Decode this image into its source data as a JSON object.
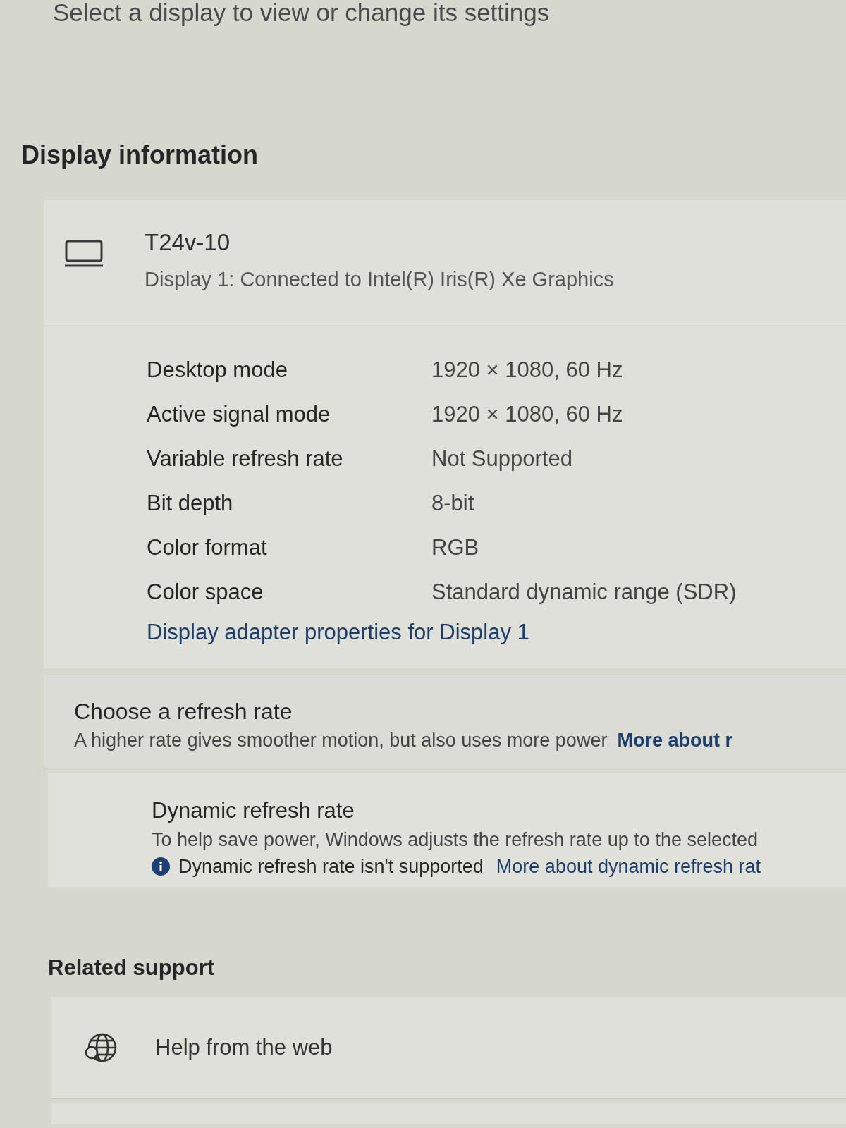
{
  "header": {
    "subtitle": "Select a display to view or change its settings"
  },
  "display_information": {
    "heading": "Display information",
    "display": {
      "name": "T24v-10",
      "description": "Display 1: Connected to Intel(R) Iris(R) Xe Graphics"
    },
    "properties": [
      {
        "label": "Desktop mode",
        "value": "1920 × 1080, 60 Hz"
      },
      {
        "label": "Active signal mode",
        "value": "1920 × 1080, 60 Hz"
      },
      {
        "label": "Variable refresh rate",
        "value": "Not Supported"
      },
      {
        "label": "Bit depth",
        "value": "8-bit"
      },
      {
        "label": "Color format",
        "value": "RGB"
      },
      {
        "label": "Color space",
        "value": "Standard dynamic range (SDR)"
      }
    ],
    "link": "Display adapter properties for Display 1"
  },
  "refresh_rate": {
    "title": "Choose a refresh rate",
    "description": "A higher rate gives smoother motion, but also uses more power",
    "link": "More about r"
  },
  "dynamic_refresh_rate": {
    "title": "Dynamic refresh rate",
    "description": "To help save power, Windows adjusts the refresh rate up to the selected",
    "notice": "Dynamic refresh rate isn't supported",
    "link": "More about dynamic refresh rat"
  },
  "related_support": {
    "heading": "Related support",
    "items": [
      {
        "label": "Help from the web"
      }
    ]
  }
}
